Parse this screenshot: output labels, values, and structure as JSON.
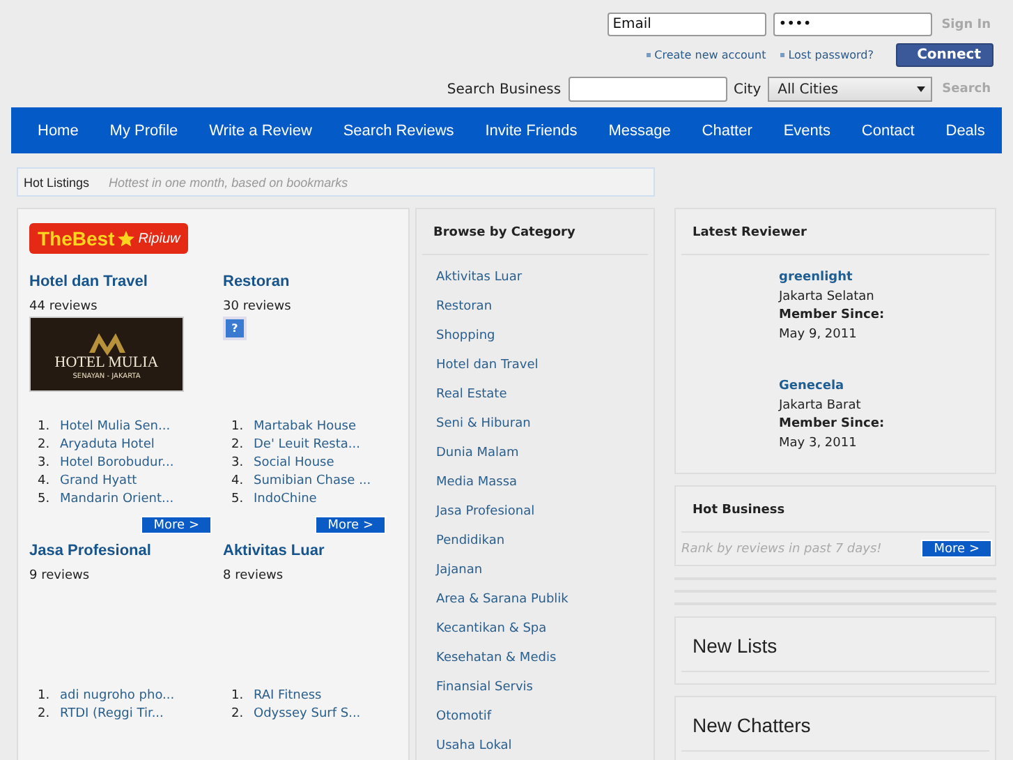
{
  "header": {
    "email": {
      "value": "Email"
    },
    "password": {
      "value": "••••"
    },
    "sign_in": "Sign In",
    "links": [
      "Create new account",
      "Lost password?"
    ],
    "connect": "Connect",
    "search_label": "Search Business",
    "city_label": "City",
    "city": {
      "value": "All Cities"
    },
    "search_button": "Search"
  },
  "nav": [
    "Home",
    "My Profile",
    "Write a Review",
    "Search Reviews",
    "Invite Friends",
    "Message",
    "Chatter",
    "Events",
    "Contact",
    "Deals"
  ],
  "hot_listings": {
    "title": "Hot Listings",
    "subtitle": "Hottest in one month, based on bookmarks"
  },
  "logo": {
    "word1": "TheBest",
    "word2": "Ripiuw"
  },
  "listings": [
    {
      "title": "Hotel dan Travel",
      "reviews": "44 reviews",
      "kind": "brand",
      "brand": {
        "name": "HOTEL MULIA",
        "tagline": "SENAYAN - JAKARTA"
      },
      "items": [
        {
          "num": "1.",
          "name": "Hotel Mulia Sen..."
        },
        {
          "num": "2.",
          "name": "Aryaduta Hotel"
        },
        {
          "num": "3.",
          "name": "Hotel Borobudur..."
        },
        {
          "num": "4.",
          "name": "Grand Hyatt"
        },
        {
          "num": "5.",
          "name": "Mandarin Orient..."
        }
      ],
      "more": "More >"
    },
    {
      "title": "Restoran",
      "reviews": "30 reviews",
      "kind": "unknown",
      "unknown_mark": "?",
      "items": [
        {
          "num": "1.",
          "name": "Martabak House"
        },
        {
          "num": "2.",
          "name": "De' Leuit Resta..."
        },
        {
          "num": "3.",
          "name": "Social House"
        },
        {
          "num": "4.",
          "name": "Sumibian Chase ..."
        },
        {
          "num": "5.",
          "name": "IndoChine"
        }
      ],
      "more": "More >"
    },
    {
      "title": "Jasa Profesional",
      "reviews": "9 reviews",
      "kind": "none",
      "items": [
        {
          "num": "1.",
          "name": "adi nugroho pho..."
        },
        {
          "num": "2.",
          "name": "RTDI (Reggi Tir..."
        }
      ]
    },
    {
      "title": "Aktivitas Luar",
      "reviews": "8 reviews",
      "kind": "none",
      "items": [
        {
          "num": "1.",
          "name": "RAI Fitness"
        },
        {
          "num": "2.",
          "name": "Odyssey Surf S..."
        }
      ]
    }
  ],
  "categories": {
    "title": "Browse by Category",
    "items": [
      "Aktivitas Luar",
      "Restoran",
      "Shopping",
      "Hotel dan Travel",
      "Real Estate",
      "Seni & Hiburan",
      "Dunia Malam",
      "Media Massa",
      "Jasa Profesional",
      "Pendidikan",
      "Jajanan",
      "Area & Sarana Publik",
      "Kecantikan & Spa",
      "Kesehatan & Medis",
      "Finansial Servis",
      "Otomotif",
      "Usaha Lokal"
    ]
  },
  "latest_reviewer": {
    "title": "Latest Reviewer",
    "reviewers": [
      {
        "name": "greenlight",
        "city": "Jakarta Selatan",
        "since_label": "Member Since:",
        "since": "May 9, 2011"
      },
      {
        "name": "Genecela",
        "city": "Jakarta Barat",
        "since_label": "Member Since:",
        "since": "May 3, 2011"
      }
    ]
  },
  "hot_business": {
    "title": "Hot Business",
    "note": "Rank by reviews in past 7 days!",
    "more": "More >"
  },
  "new_lists": {
    "title": "New Lists"
  },
  "new_chatters": {
    "title": "New Chatters"
  }
}
